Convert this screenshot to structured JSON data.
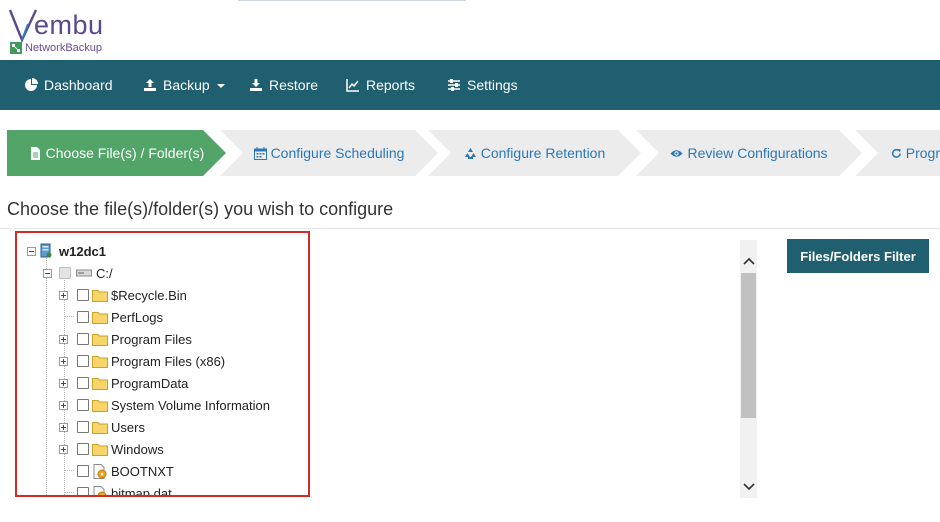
{
  "brand": {
    "name": "embu",
    "product": "NetworkBackup",
    "accent": "#1f5f6f"
  },
  "nav": {
    "items": [
      {
        "label": "Dashboard",
        "icon": "pie-chart-icon"
      },
      {
        "label": "Backup",
        "icon": "upload-icon",
        "has_dropdown": true
      },
      {
        "label": "Restore",
        "icon": "download-icon"
      },
      {
        "label": "Reports",
        "icon": "line-chart-icon"
      },
      {
        "label": "Settings",
        "icon": "sliders-icon"
      }
    ]
  },
  "wizard": {
    "steps": [
      {
        "label": "Choose File(s) / Folder(s)",
        "icon": "file-icon",
        "active": true
      },
      {
        "label": "Configure Scheduling",
        "icon": "calendar-icon",
        "active": false
      },
      {
        "label": "Configure Retention",
        "icon": "recycle-icon",
        "active": false
      },
      {
        "label": "Review Configurations",
        "icon": "eye-icon",
        "active": false
      },
      {
        "label": "Progr",
        "icon": "refresh-icon",
        "active": false
      }
    ],
    "active_color": "#52a468"
  },
  "main": {
    "title": "Choose the file(s)/folder(s) you wish to configure",
    "filter_button": "Files/Folders Filter"
  },
  "tree": {
    "root": "w12dc1",
    "drive": "C:/",
    "items": [
      {
        "label": "$Recycle.Bin",
        "type": "folder",
        "expandable": true
      },
      {
        "label": "PerfLogs",
        "type": "folder",
        "expandable": false
      },
      {
        "label": "Program Files",
        "type": "folder",
        "expandable": true
      },
      {
        "label": "Program Files (x86)",
        "type": "folder",
        "expandable": true
      },
      {
        "label": "ProgramData",
        "type": "folder",
        "expandable": true
      },
      {
        "label": "System Volume Information",
        "type": "folder",
        "expandable": true
      },
      {
        "label": "Users",
        "type": "folder",
        "expandable": true
      },
      {
        "label": "Windows",
        "type": "folder",
        "expandable": true
      },
      {
        "label": "BOOTNXT",
        "type": "file",
        "expandable": false
      },
      {
        "label": "bitmap.dat",
        "type": "file",
        "expandable": false
      }
    ]
  }
}
